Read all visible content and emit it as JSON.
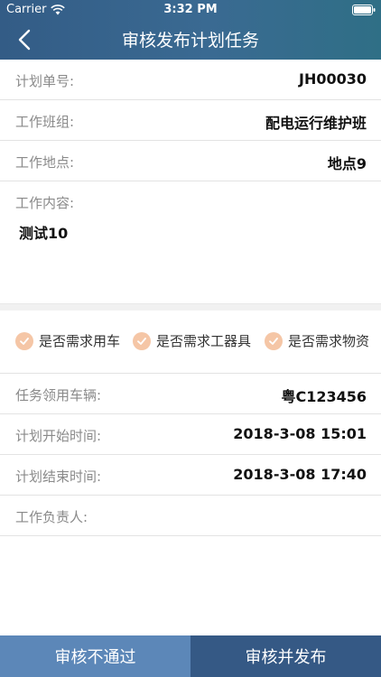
{
  "status_bar": {
    "carrier": "Carrier",
    "time": "3:32 PM",
    "icons": [
      "wifi-icon",
      "battery-icon"
    ]
  },
  "nav": {
    "title": "审核发布计划任务",
    "back_icon": "chevron-left-icon"
  },
  "fields": {
    "plan_no": {
      "label": "计划单号:",
      "value": "JH00030"
    },
    "team": {
      "label": "工作班组:",
      "value": "配电运行维护班"
    },
    "location": {
      "label": "工作地点:",
      "value": "地点9"
    },
    "content": {
      "label": "工作内容:",
      "value": "测试10"
    }
  },
  "requirements": [
    {
      "label": "是否需求用车",
      "checked": true
    },
    {
      "label": "是否需求工器具",
      "checked": true
    },
    {
      "label": "是否需求物资",
      "checked": true
    }
  ],
  "details": {
    "vehicle": {
      "label": "任务领用车辆:",
      "value": "粤C123456"
    },
    "start_time": {
      "label": "计划开始时间:",
      "value": "2018-3-08 15:01"
    },
    "end_time": {
      "label": "计划结束时间:",
      "value": "2018-3-08 17:40"
    },
    "leader": {
      "label": "工作负责人:",
      "value": ""
    }
  },
  "actions": {
    "reject": "审核不通过",
    "publish": "审核并发布"
  },
  "colors": {
    "header": "#3a6a92",
    "check": "#f5c6a6",
    "reject_button": "#5c87b8",
    "publish_button": "#355985"
  }
}
